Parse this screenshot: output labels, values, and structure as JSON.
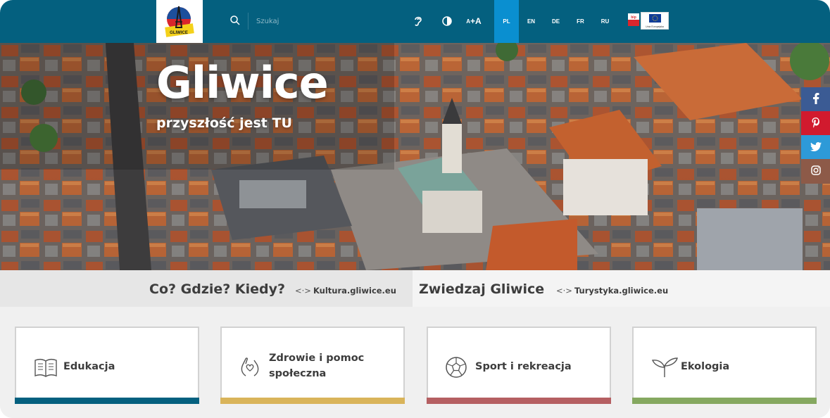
{
  "header": {
    "logo_text": "GLIWICE",
    "search_placeholder": "Szukaj",
    "font_small": "A",
    "font_big": "+A",
    "languages": [
      "PL",
      "EN",
      "DE",
      "FR",
      "RU"
    ],
    "active_language": "PL",
    "bip_text": "bip",
    "eu_text": "Unia Europejska",
    "accent": "#04607f",
    "active_color": "#0a8fd0"
  },
  "hero": {
    "title": "Gliwice",
    "subtitle": "przyszłość jest TU"
  },
  "social": [
    "facebook",
    "pinterest",
    "twitter",
    "instagram"
  ],
  "links": [
    {
      "heading": "Co? Gdzie? Kiedy?",
      "link": "Kultura.gliwice.eu",
      "arrow": "<·>"
    },
    {
      "heading": "Zwiedzaj Gliwice",
      "link": "Turystyka.gliwice.eu",
      "arrow": "<·>"
    }
  ],
  "categories": [
    {
      "label": "Edukacja",
      "icon": "book-icon",
      "color": "#04607f"
    },
    {
      "label": "Zdrowie i pomoc społeczna",
      "label_line1": "Zdrowie i pomoc",
      "label_line2": "społeczna",
      "icon": "hands-heart-icon",
      "color": "#d9b45a"
    },
    {
      "label": "Sport i rekreacja",
      "icon": "soccer-ball-icon",
      "color": "#b55f62"
    },
    {
      "label": "Ekologia",
      "icon": "sprout-icon",
      "color": "#85a860"
    }
  ]
}
